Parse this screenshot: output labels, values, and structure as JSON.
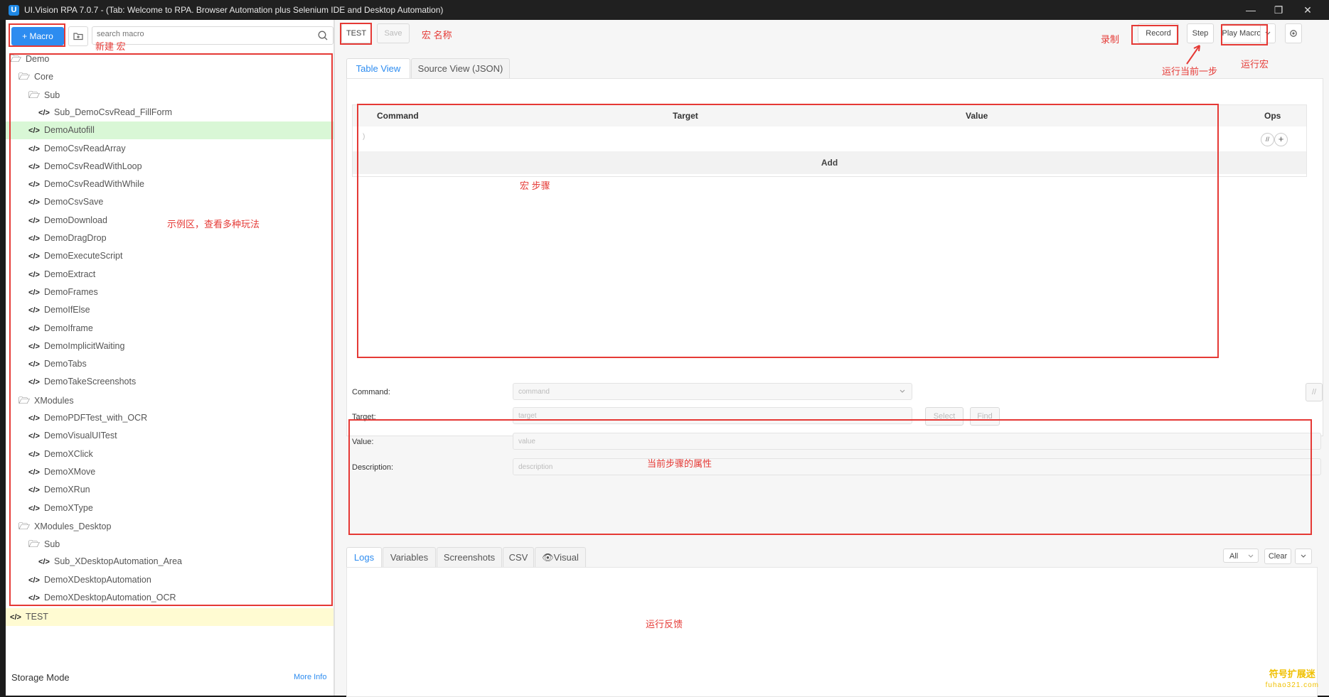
{
  "window": {
    "title": "UI.Vision RPA 7.0.7 - (Tab: Welcome to RPA. Browser Automation plus Selenium IDE and Desktop Automation)",
    "app_icon": "U",
    "controls": [
      "—",
      "❐",
      "✕"
    ]
  },
  "sidebar": {
    "new_macro_label": "+ Macro",
    "search_placeholder": "search macro",
    "tree": [
      {
        "label": "Demo",
        "icon": "folder-open-icon",
        "level": 0
      },
      {
        "label": "Core",
        "icon": "folder-open-icon",
        "level": 1
      },
      {
        "label": "Sub",
        "icon": "folder-open-icon",
        "level": 2
      },
      {
        "label": "Sub_DemoCsvRead_FillForm",
        "icon": "code-icon",
        "level": 3
      },
      {
        "label": "DemoAutofill",
        "icon": "code-icon",
        "level": 2,
        "selected": true
      },
      {
        "label": "DemoCsvReadArray",
        "icon": "code-icon",
        "level": 2
      },
      {
        "label": "DemoCsvReadWithLoop",
        "icon": "code-icon",
        "level": 2
      },
      {
        "label": "DemoCsvReadWithWhile",
        "icon": "code-icon",
        "level": 2
      },
      {
        "label": "DemoCsvSave",
        "icon": "code-icon",
        "level": 2
      },
      {
        "label": "DemoDownload",
        "icon": "code-icon",
        "level": 2
      },
      {
        "label": "DemoDragDrop",
        "icon": "code-icon",
        "level": 2
      },
      {
        "label": "DemoExecuteScript",
        "icon": "code-icon",
        "level": 2
      },
      {
        "label": "DemoExtract",
        "icon": "code-icon",
        "level": 2
      },
      {
        "label": "DemoFrames",
        "icon": "code-icon",
        "level": 2
      },
      {
        "label": "DemoIfElse",
        "icon": "code-icon",
        "level": 2
      },
      {
        "label": "DemoIframe",
        "icon": "code-icon",
        "level": 2
      },
      {
        "label": "DemoImplicitWaiting",
        "icon": "code-icon",
        "level": 2
      },
      {
        "label": "DemoTabs",
        "icon": "code-icon",
        "level": 2
      },
      {
        "label": "DemoTakeScreenshots",
        "icon": "code-icon",
        "level": 2
      },
      {
        "label": "XModules",
        "icon": "folder-open-icon",
        "level": 1
      },
      {
        "label": "DemoPDFTest_with_OCR",
        "icon": "code-icon",
        "level": 2
      },
      {
        "label": "DemoVisualUITest",
        "icon": "code-icon",
        "level": 2
      },
      {
        "label": "DemoXClick",
        "icon": "code-icon",
        "level": 2
      },
      {
        "label": "DemoXMove",
        "icon": "code-icon",
        "level": 2
      },
      {
        "label": "DemoXRun",
        "icon": "code-icon",
        "level": 2
      },
      {
        "label": "DemoXType",
        "icon": "code-icon",
        "level": 2
      },
      {
        "label": "XModules_Desktop",
        "icon": "folder-open-icon",
        "level": 1
      },
      {
        "label": "Sub",
        "icon": "folder-open-icon",
        "level": 2
      },
      {
        "label": "Sub_XDesktopAutomation_Area",
        "icon": "code-icon",
        "level": 3
      },
      {
        "label": "DemoXDesktopAutomation",
        "icon": "code-icon",
        "level": 2
      },
      {
        "label": "DemoXDesktopAutomation_OCR",
        "icon": "code-icon",
        "level": 2
      },
      {
        "label": "TEST",
        "icon": "code-icon",
        "level": 0,
        "active": true
      }
    ],
    "storage_mode": "Storage Mode",
    "more_info": "More Info"
  },
  "toolbar": {
    "macro_name": "TEST",
    "save_label": "Save",
    "record_label": "Record",
    "step_label": "Step",
    "play_label": "Play Macro",
    "dropdown_icon": "chevron-down-icon",
    "settings_icon": "gear-icon"
  },
  "editor": {
    "tabs": [
      "Table View",
      "Source View (JSON)"
    ],
    "active_tab": "Table View",
    "columns": [
      "Command",
      "Target",
      "Value",
      "Ops"
    ],
    "row_marker": ")",
    "add_label": "Add",
    "ops_comment": "//",
    "ops_add": "+"
  },
  "properties": {
    "command_label": "Command:",
    "command_placeholder": "command",
    "target_label": "Target:",
    "target_placeholder": "target",
    "value_label": "Value:",
    "value_placeholder": "value",
    "description_label": "Description:",
    "description_placeholder": "description",
    "select_label": "Select",
    "find_label": "Find",
    "comment_toggle": "//"
  },
  "logs": {
    "tabs": [
      "Logs",
      "Variables",
      "Screenshots",
      "CSV",
      "👁Visual"
    ],
    "active_tab": "Logs",
    "filter_value": "All",
    "clear_label": "Clear"
  },
  "annotations": {
    "new_macro": "新建 宏",
    "macro_name": "宏 名称",
    "record": "录制",
    "step": "运行当前一步",
    "play": "运行宏",
    "steps": "宏 步骤",
    "examples": "示例区，查看多种玩法",
    "properties": "当前步骤的属性",
    "feedback": "运行反馈"
  },
  "watermark": {
    "line1": "符号扩展迷",
    "line2": "fuhao321.com"
  },
  "colors": {
    "accent": "#2d8cf0",
    "annotation_red": "#e53935",
    "selected_row": "#d9f7d6",
    "active_row": "#fffbd2"
  }
}
